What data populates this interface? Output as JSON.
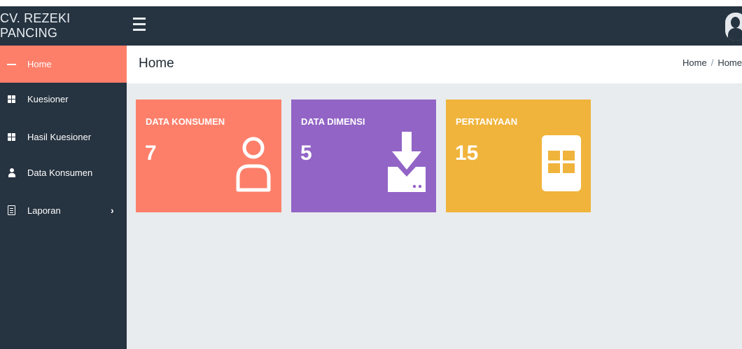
{
  "navbar": {
    "brand": "CV. REZEKI PANCING",
    "toggle_icon": "hamburger-icon",
    "avatar_icon": "user-avatar-icon",
    "bg_color": "#263340"
  },
  "sidebar": {
    "items": [
      {
        "label": "Home",
        "icon": "bars-icon",
        "active": true
      },
      {
        "label": "Kuesioner",
        "icon": "grid-icon"
      },
      {
        "label": "Hasil Kuesioner",
        "icon": "grid-icon"
      },
      {
        "label": "Data Konsumen",
        "icon": "user-icon"
      },
      {
        "label": "Laporan",
        "icon": "document-icon",
        "has_submenu": true
      }
    ],
    "active_color": "#fd7f6a"
  },
  "header": {
    "title": "Home",
    "breadcrumb": [
      "Home",
      "Home"
    ]
  },
  "cards": [
    {
      "title": "DATA KONSUMEN",
      "value": "7",
      "icon": "user-outline-icon",
      "color": "#fd7f6a"
    },
    {
      "title": "DATA DIMENSI",
      "value": "5",
      "icon": "download-icon",
      "color": "#9264c6"
    },
    {
      "title": "PERTANYAAN",
      "value": "15",
      "icon": "grid-icon",
      "color": "#f0b43c"
    }
  ]
}
